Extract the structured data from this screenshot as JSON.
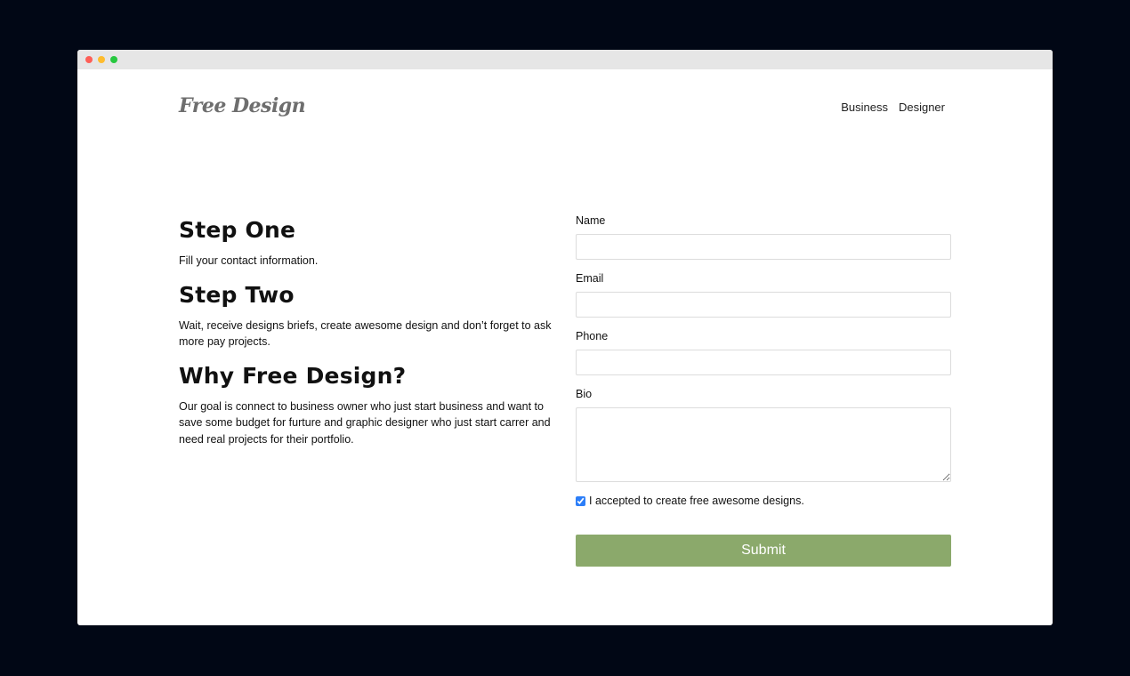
{
  "site": {
    "logo": "Free Design",
    "nav": [
      "Business",
      "Designer"
    ]
  },
  "steps": [
    {
      "title": "Step One",
      "text": "Fill your contact information."
    },
    {
      "title": "Step Two",
      "text": "Wait, receive designs briefs, create awesome design and don’t forget to ask more pay projects."
    },
    {
      "title": "Why Free Design?",
      "text": "Our goal is connect to business owner who just start business and want to save some budget for furture and graphic designer who just start carrer and need real projects for their portfolio."
    }
  ],
  "form": {
    "name_label": "Name",
    "name_value": "",
    "email_label": "Email",
    "email_value": "",
    "phone_label": "Phone",
    "phone_value": "",
    "bio_label": "Bio",
    "bio_value": "",
    "checkbox_label": "I accepted to create free awesome designs.",
    "checkbox_checked": true,
    "submit_label": "Submit"
  },
  "colors": {
    "accent": "#8ba96b",
    "background": "#010715",
    "checkbox": "#2c7ef8"
  }
}
